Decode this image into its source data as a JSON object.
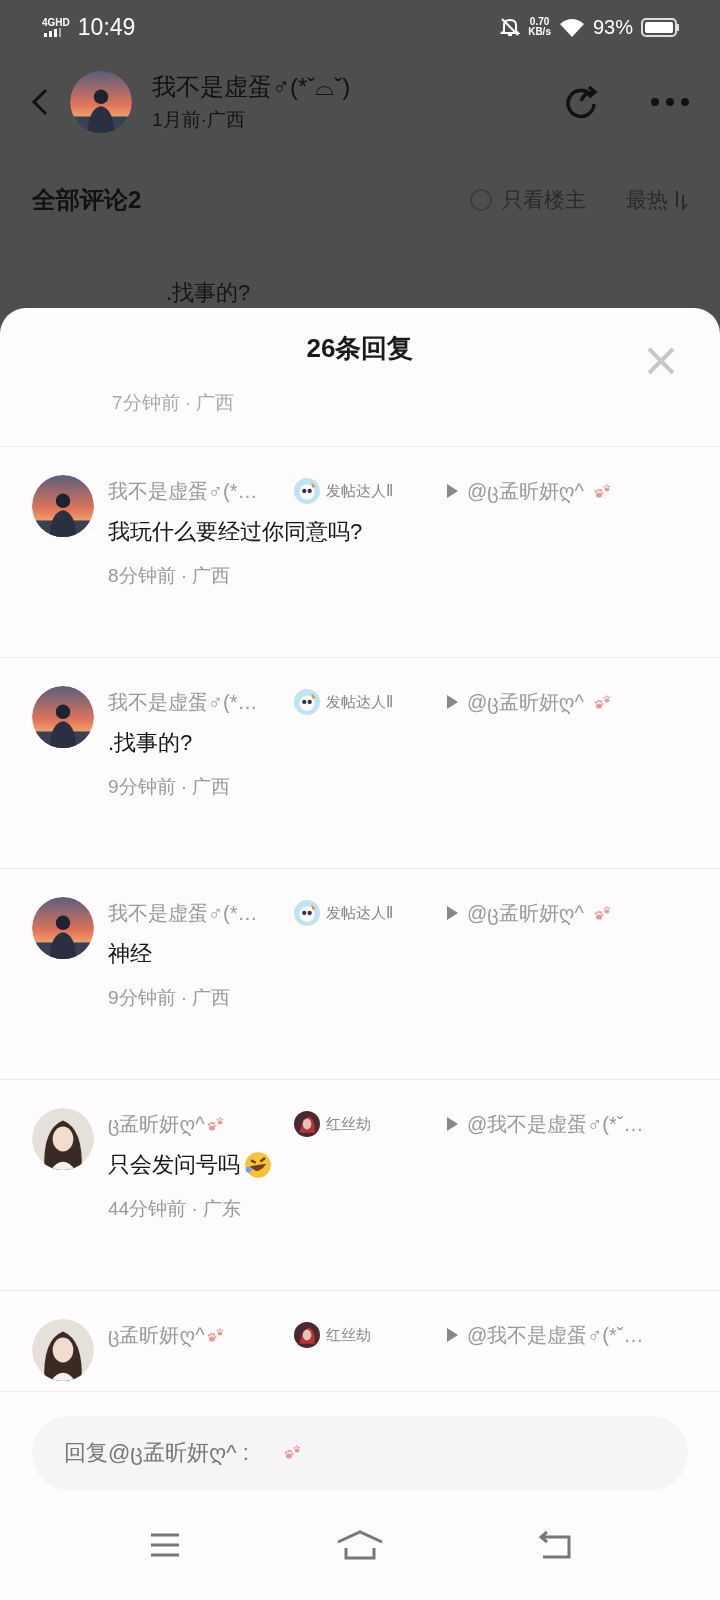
{
  "status_bar": {
    "network": "4GHD",
    "time": "10:49",
    "speed": "0.70",
    "speed_unit": "KB/s",
    "battery": "93%"
  },
  "post_header": {
    "author": "我不是虚蛋♂(*ˇ⌓ˇ)",
    "meta": "1月前·广西"
  },
  "comments_bar": {
    "title": "全部评论2",
    "filter": {
      "label": "只看楼主",
      "checked": false
    },
    "sort": "最热"
  },
  "background_comment": {
    "text": ".找事的?"
  },
  "sheet": {
    "title": "26条回复",
    "partial_meta": "7分钟前 · 广西",
    "replies": [
      {
        "avatar": {
          "kind": "sunset"
        },
        "name": "我不是虚蛋♂(*…",
        "name_paw": false,
        "badge": {
          "label": "发帖达人Ⅱ",
          "kind": "owl"
        },
        "target": "@ც孟昕妍ღ^",
        "target_paw": true,
        "text": "我玩什么要经过你同意吗?",
        "emoji": false,
        "meta": "8分钟前 · 广西"
      },
      {
        "avatar": {
          "kind": "sunset"
        },
        "name": "我不是虚蛋♂(*…",
        "name_paw": false,
        "badge": {
          "label": "发帖达人Ⅱ",
          "kind": "owl"
        },
        "target": "@ც孟昕妍ღ^",
        "target_paw": true,
        "text": ".找事的?",
        "emoji": false,
        "meta": "9分钟前 · 广西"
      },
      {
        "avatar": {
          "kind": "sunset"
        },
        "name": "我不是虚蛋♂(*…",
        "name_paw": false,
        "badge": {
          "label": "发帖达人Ⅱ",
          "kind": "owl"
        },
        "target": "@ც孟昕妍ღ^",
        "target_paw": true,
        "text": "神经",
        "emoji": false,
        "meta": "9分钟前 · 广西"
      },
      {
        "avatar": {
          "kind": "portrait"
        },
        "name": "ც孟昕妍ღ^",
        "name_paw": true,
        "badge": {
          "label": "红丝劫",
          "kind": "red"
        },
        "target": "@我不是虚蛋♂(*ˇ…",
        "target_paw": false,
        "text": "只会发问号吗",
        "emoji": true,
        "meta": "44分钟前 · 广东"
      },
      {
        "avatar": {
          "kind": "portrait"
        },
        "name": "ც孟昕妍ღ^",
        "name_paw": true,
        "badge": {
          "label": "红丝劫",
          "kind": "red"
        },
        "target": "@我不是虚蛋♂(*ˇ…",
        "target_paw": false
      }
    ],
    "reply_field": {
      "placeholder": "回复@ც孟昕妍ღ^ :"
    }
  }
}
